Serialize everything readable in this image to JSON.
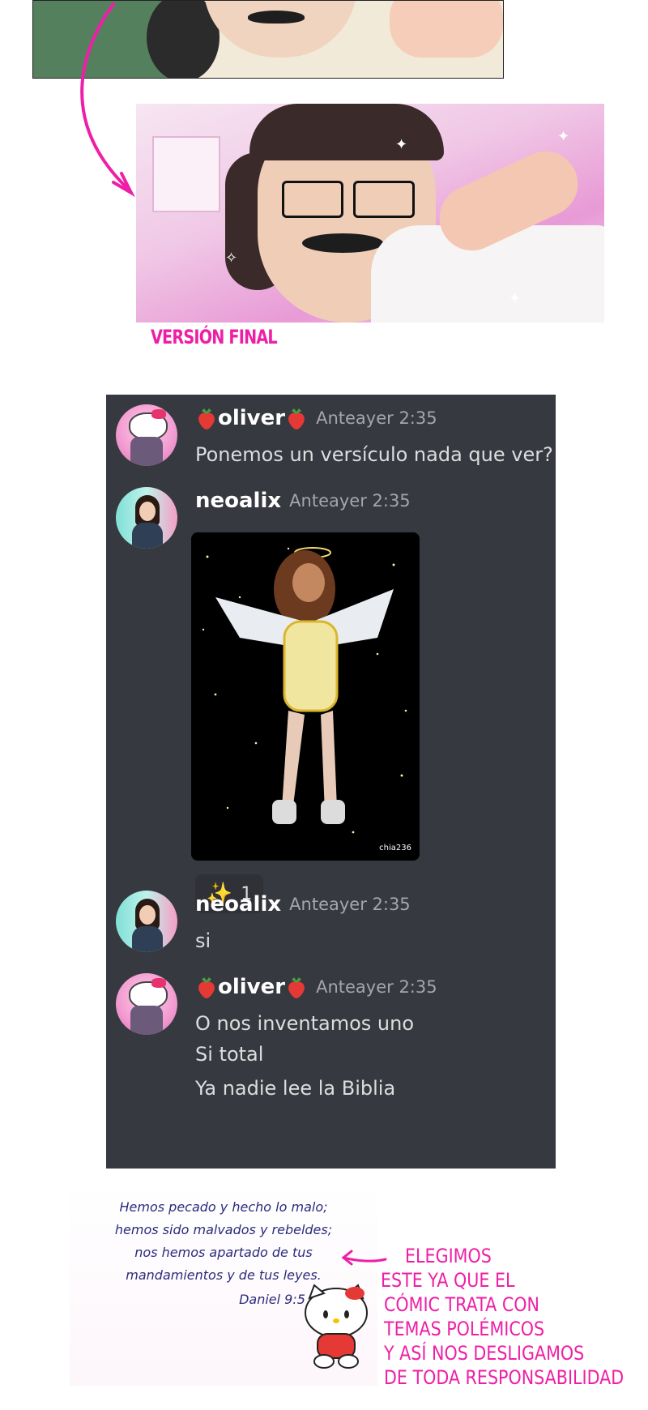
{
  "label_final": "VERSIÓN FINAL",
  "chat": {
    "messages": [
      {
        "user": "oliver",
        "time": "Anteayer 2:35",
        "lines": [
          "Ponemos un versículo nada que ver?"
        ]
      },
      {
        "user": "neoalix",
        "time": "Anteayer 2:35",
        "image_credit": "chia236",
        "reaction": {
          "emoji": "sparkles-icon",
          "count": "1"
        }
      },
      {
        "user": "neoalix",
        "time": "Anteayer 2:35",
        "lines": [
          "si"
        ]
      },
      {
        "user": "oliver",
        "time": "Anteayer 2:35",
        "lines": [
          "O nos inventamos uno",
          "Si total",
          "Ya nadie lee la Biblia"
        ]
      }
    ]
  },
  "verse": {
    "lines": [
      "Hemos pecado y hecho lo malo;",
      "hemos sido malvados y rebeldes;",
      "nos hemos apartado de tus",
      "mandamientos y de tus leyes."
    ],
    "reference": "Daniel 9:5"
  },
  "note": {
    "lines": [
      "ELEGIMOS",
      "ESTE YA QUE EL",
      "CÓMIC TRATA CON",
      "TEMAS POLÉMICOS",
      "Y ASÍ NOS DESLIGAMOS",
      "DE TODA RESPONSABILIDAD"
    ]
  },
  "colors": {
    "chat_bg": "#36393f",
    "accent_pink": "#ee1fa6",
    "username": "#ffffff",
    "timestamp": "#a3a6aa",
    "message_text": "#dcddde"
  }
}
